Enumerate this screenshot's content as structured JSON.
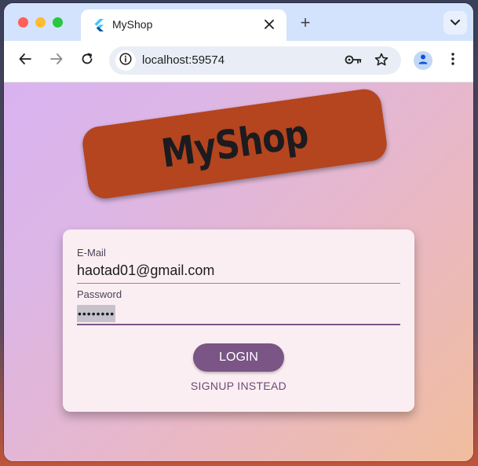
{
  "browser": {
    "tab": {
      "title": "MyShop",
      "close_icon": "close-icon",
      "favicon": "flutter-icon"
    },
    "new_tab_label": "+",
    "url": "localhost:59574",
    "icons": {
      "back": "arrow-left-icon",
      "forward": "arrow-right-icon",
      "reload": "reload-icon",
      "site_info": "info-icon",
      "password": "key-icon",
      "bookmark": "star-icon",
      "profile": "person-icon",
      "menu": "more-vert-icon",
      "tab_search": "chevron-down-icon"
    },
    "colors": {
      "tabstrip": "#d3e3fd",
      "omnibox": "#e9eef6",
      "close_dot": "#ff5f57",
      "minimize_dot": "#febc2e",
      "zoom_dot": "#28c840"
    }
  },
  "app": {
    "logo_text": "MyShop",
    "colors": {
      "banner": "#b4451f",
      "card": "#fbeef3",
      "primary": "#7a5585"
    },
    "form": {
      "email_label": "E-Mail",
      "email_value": "haotad01@gmail.com",
      "password_label": "Password",
      "password_value": "••••••••",
      "login_label": "LOGIN",
      "signup_label": "SIGNUP INSTEAD"
    }
  }
}
